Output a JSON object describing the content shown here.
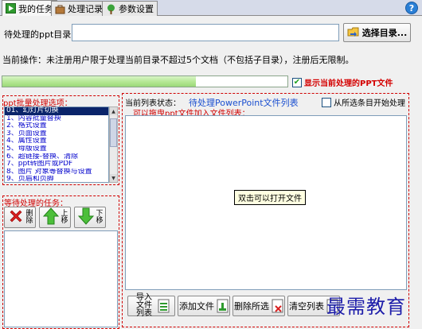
{
  "tabs": [
    {
      "label": "我的任务",
      "icon": "play-icon",
      "active": true
    },
    {
      "label": "处理记录",
      "icon": "briefcase-icon",
      "active": false
    },
    {
      "label": "参数设置",
      "icon": "tree-icon",
      "active": false
    }
  ],
  "help_label": "?",
  "dir_label": "待处理的ppt目录：",
  "dir_value": "",
  "browse_label": "选择目录...",
  "current_op": "当前操作：未注册用户限于处理当前目录不超过5个文档（不包括子目录），注册后无限制。",
  "progress": 0.68,
  "show_current_label": "显示当前处理的PPT文件",
  "show_current_checked": true,
  "options_label": "ppt批量处理选项：",
  "options": [
    "01、幻灯片切换",
    "1、内容批量替换",
    "2、格式设置",
    "3、页面设置",
    "4、属性设置",
    "5、母版设置",
    "6、超链接-替换、清除",
    "7、ppt转图片或PDF",
    "8、图片 对象等替换与设置",
    "9、页眉和页脚"
  ],
  "options_selected": 0,
  "waiting_label": "等待处理的任务：",
  "task_buttons": {
    "delete": "删除",
    "up": "上移",
    "down": "下移"
  },
  "list_state_label": "当前列表状态：",
  "file_list_title": "待处理PowerPoint文件列表",
  "from_selected_label": "从所选条目开始处理",
  "drag_hint": "可以拖曳ppt文件加入文件列表：",
  "tooltip": "双击可以打开文件",
  "bottom_buttons": {
    "import": "导入文件列表",
    "add": "添加文件",
    "delete_sel": "删除所选",
    "clear": "清空列表"
  },
  "watermark": "最需教育",
  "colors": {
    "accent_red": "#d00000",
    "title_blue": "#1a4fd0",
    "progress_green": "#b6e896"
  }
}
